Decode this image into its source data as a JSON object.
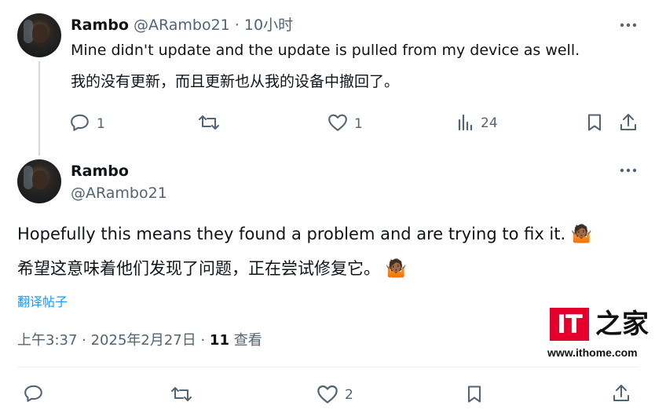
{
  "reply": {
    "author_name": "Rambo",
    "author_handle": "@ARambo21",
    "time_ago": "10小时",
    "text_en": "Mine didn't update and the update is pulled from my device as well.",
    "text_zh": "我的没有更新，而且更新也从我的设备中撤回了。",
    "reply_count": "1",
    "like_count": "1",
    "view_count": "24"
  },
  "main_post": {
    "author_name": "Rambo",
    "author_handle": "@ARambo21",
    "text_en": "Hopefully this means they found a problem and are trying to fix it.",
    "text_zh": "希望这意味着他们发现了问题，正在尝试修复它。",
    "emoji": "🤷🏾",
    "translate_label": "翻译帖子",
    "timestamp": "上午3:37 · 2025年2月27日 · ",
    "views_number": "11",
    "views_label": " 查看",
    "like_count": "2"
  },
  "watermark": {
    "logo_text": "IT",
    "logo_cn": "之家",
    "url": "www.ithome.com",
    "color": "#e4002b"
  },
  "colors": {
    "text": "#0f1419",
    "secondary": "#536471",
    "link": "#1d9bf0",
    "divider": "#eff3f4"
  }
}
